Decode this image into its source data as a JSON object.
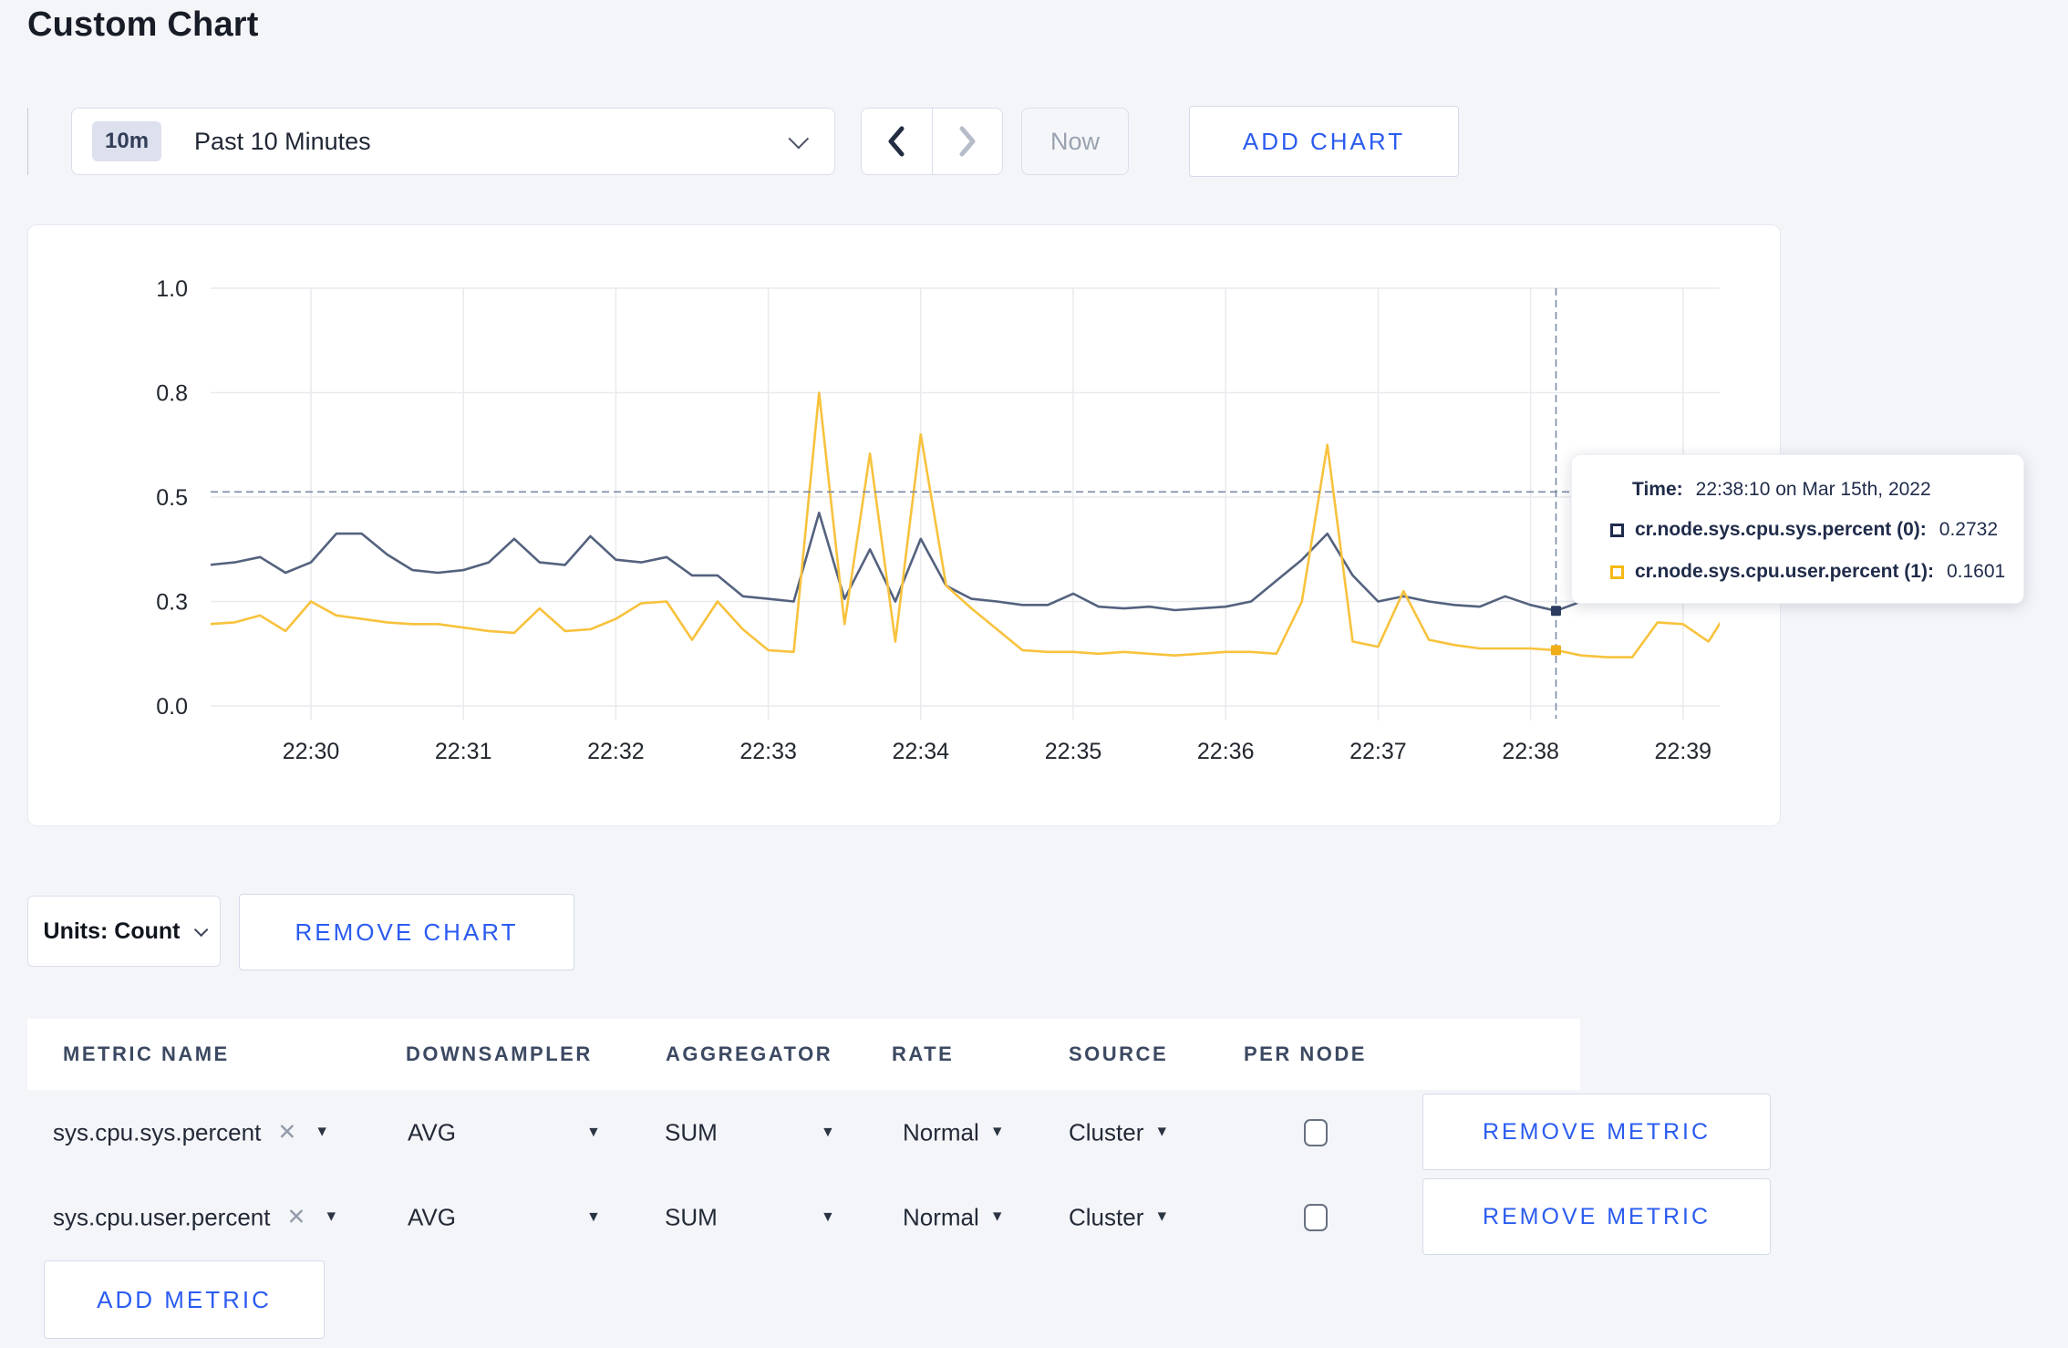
{
  "page": {
    "title": "Custom Chart",
    "background": "#f4f5f9",
    "accent_blue": "#2b5cf0"
  },
  "toolbar": {
    "time_range": {
      "badge": "10m",
      "label": "Past 10 Minutes"
    },
    "now_label": "Now",
    "add_chart_label": "ADD CHART"
  },
  "chart_footer": {
    "units_label": "Units: Count",
    "remove_chart_label": "REMOVE CHART"
  },
  "tooltip": {
    "time_label": "Time:",
    "time_value": "22:38:10 on Mar 15th, 2022",
    "series": [
      {
        "name": "cr.node.sys.cpu.sys.percent (0):",
        "value": "0.2732",
        "swatch_color": "#1e2b4d"
      },
      {
        "name": "cr.node.sys.cpu.user.percent (1):",
        "value": "0.1601",
        "swatch_color": "#f5b916"
      }
    ]
  },
  "chart_data": {
    "type": "line",
    "title": "",
    "xlabel": "",
    "ylabel": "",
    "grid": true,
    "legend_position": "tooltip",
    "y_ticks": [
      0.0,
      0.3,
      0.5,
      0.8,
      1.0
    ],
    "y_tick_labels": [
      "0.0",
      "0.3",
      "0.5",
      "0.8",
      "1.0"
    ],
    "y_ticks_evenly_spaced": true,
    "x_tick_labels": [
      "22:30",
      "22:31",
      "22:32",
      "22:33",
      "22:34",
      "22:35",
      "22:36",
      "22:37",
      "22:38",
      "22:39"
    ],
    "x_start_seconds": -40,
    "x_step_seconds": 10,
    "crosshair": {
      "x_time": "22:38:10",
      "x_seconds": 490,
      "y_value": 0.515,
      "color": "#7b89a3"
    },
    "hover_points": [
      {
        "series": 0,
        "value": 0.2732
      },
      {
        "series": 1,
        "value": 0.1601
      }
    ],
    "series": [
      {
        "name": "cr.node.sys.cpu.sys.percent (0)",
        "color": "#54627e",
        "marker_color": "#2c3c60",
        "values": [
          0.37,
          0.375,
          0.385,
          0.355,
          0.375,
          0.43,
          0.43,
          0.39,
          0.36,
          0.355,
          0.36,
          0.375,
          0.42,
          0.375,
          0.37,
          0.425,
          0.38,
          0.375,
          0.385,
          0.35,
          0.35,
          0.31,
          0.305,
          0.3,
          0.47,
          0.305,
          0.4,
          0.3,
          0.42,
          0.33,
          0.305,
          0.3,
          0.29,
          0.29,
          0.315,
          0.285,
          0.28,
          0.285,
          0.275,
          0.28,
          0.285,
          0.3,
          0.34,
          0.38,
          0.43,
          0.35,
          0.3,
          0.31,
          0.3,
          0.29,
          0.285,
          0.31,
          0.29,
          0.2732,
          0.3,
          0.3,
          0.315,
          0.3,
          0.3,
          0.305,
          0.3
        ]
      },
      {
        "name": "cr.node.sys.cpu.user.percent (1)",
        "color": "#f8c23d",
        "marker_color": "#f0ad17",
        "values": [
          0.235,
          0.24,
          0.26,
          0.215,
          0.3,
          0.26,
          0.25,
          0.24,
          0.235,
          0.235,
          0.225,
          0.215,
          0.21,
          0.28,
          0.215,
          0.22,
          0.25,
          0.295,
          0.3,
          0.19,
          0.3,
          0.22,
          0.16,
          0.155,
          0.8,
          0.235,
          0.625,
          0.185,
          0.68,
          0.33,
          0.28,
          0.22,
          0.16,
          0.155,
          0.155,
          0.15,
          0.155,
          0.15,
          0.145,
          0.15,
          0.155,
          0.155,
          0.15,
          0.3,
          0.65,
          0.185,
          0.17,
          0.32,
          0.19,
          0.175,
          0.165,
          0.165,
          0.165,
          0.1601,
          0.145,
          0.14,
          0.14,
          0.24,
          0.235,
          0.185,
          0.3
        ]
      }
    ]
  },
  "metrics_table": {
    "headers": [
      "METRIC NAME",
      "DOWNSAMPLER",
      "AGGREGATOR",
      "RATE",
      "SOURCE",
      "PER NODE"
    ],
    "rows": [
      {
        "metric_name": "sys.cpu.sys.percent",
        "downsampler": "AVG",
        "aggregator": "SUM",
        "rate": "Normal",
        "source": "Cluster",
        "per_node_checked": false,
        "remove_label": "REMOVE METRIC"
      },
      {
        "metric_name": "sys.cpu.user.percent",
        "downsampler": "AVG",
        "aggregator": "SUM",
        "rate": "Normal",
        "source": "Cluster",
        "per_node_checked": false,
        "remove_label": "REMOVE METRIC"
      }
    ],
    "add_metric_label": "ADD METRIC"
  }
}
